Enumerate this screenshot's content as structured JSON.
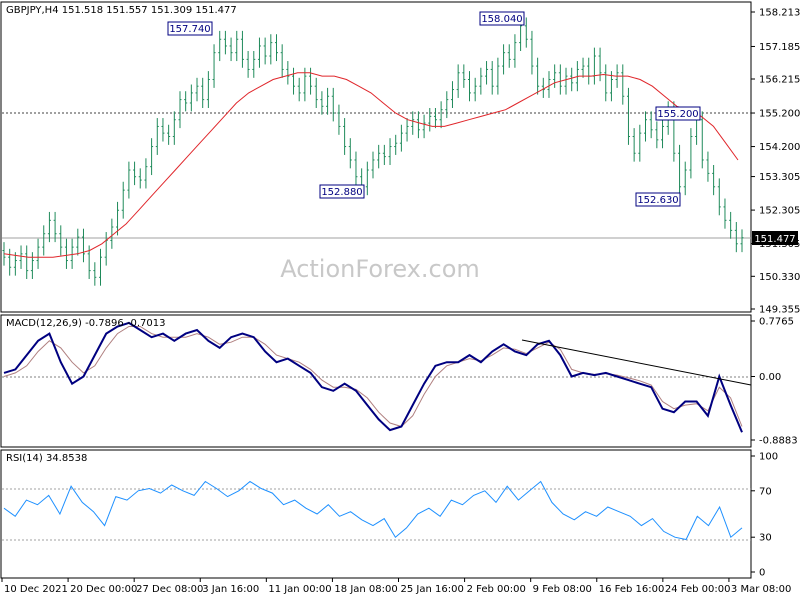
{
  "colors": {
    "background": "#ffffff",
    "candles": "#1f8a5a",
    "ma_line": "#e0262b",
    "macd_line": "#000080",
    "macd_signal": "#a07070",
    "rsi_line": "#1e90ff",
    "grid_dash": "#808080",
    "text": "#000000",
    "price_tag_bg": "#000000"
  },
  "header": {
    "symbol": "GBPJPY,H4",
    "ohlc": "151.518 151.557 151.309 151.477"
  },
  "watermark": "ActionForex.com",
  "chart_data": [
    {
      "type": "candlestick",
      "symbol": "GBPJPY",
      "timeframe": "H4",
      "open": 151.518,
      "high": 151.557,
      "low": 151.309,
      "close": 151.477,
      "current_price_label": "151.477",
      "ylim": [
        149.355,
        158.213
      ],
      "y_ticks": [
        "158.213",
        "157.185",
        "156.215",
        "155.200",
        "154.200",
        "153.305",
        "152.305",
        "151.305",
        "150.330",
        "149.355"
      ],
      "dashed_level": 155.2,
      "annotations": [
        {
          "text": "157.740",
          "value": 157.74
        },
        {
          "text": "158.040",
          "value": 158.04
        },
        {
          "text": "152.880",
          "value": 152.88
        },
        {
          "text": "155.200",
          "value": 155.2
        },
        {
          "text": "152.630",
          "value": 152.63
        }
      ],
      "closes": [
        150.9,
        150.6,
        150.8,
        151.0,
        150.5,
        150.8,
        151.2,
        151.6,
        152.0,
        151.6,
        151.2,
        150.8,
        151.2,
        151.5,
        151.0,
        150.5,
        150.3,
        150.9,
        151.4,
        151.8,
        152.3,
        152.9,
        153.5,
        153.3,
        153.2,
        153.6,
        154.2,
        154.8,
        154.6,
        154.5,
        155.0,
        155.6,
        155.5,
        155.8,
        156.0,
        155.6,
        156.2,
        157.0,
        157.4,
        157.2,
        157.0,
        157.4,
        156.8,
        156.5,
        156.8,
        157.2,
        156.9,
        157.3,
        157.0,
        156.5,
        156.3,
        156.0,
        155.8,
        156.3,
        156.0,
        155.6,
        155.4,
        155.7,
        155.2,
        154.8,
        154.2,
        153.8,
        153.3,
        153.0,
        153.5,
        153.8,
        154.0,
        153.9,
        154.2,
        154.3,
        154.6,
        154.8,
        155.0,
        154.7,
        154.9,
        155.1,
        155.0,
        155.3,
        155.6,
        155.9,
        156.4,
        156.2,
        155.8,
        156.0,
        156.3,
        156.5,
        156.0,
        156.6,
        157.0,
        156.8,
        157.3,
        157.8,
        157.4,
        156.6,
        156.0,
        155.9,
        156.2,
        156.4,
        156.0,
        156.3,
        156.1,
        156.5,
        156.6,
        156.3,
        156.9,
        156.4,
        155.8,
        156.2,
        156.4,
        155.7,
        154.5,
        154.0,
        154.6,
        155.0,
        154.7,
        154.4,
        154.8,
        155.3,
        154.0,
        153.0,
        153.5,
        154.5,
        155.0,
        153.8,
        153.4,
        153.0,
        152.4,
        152.0,
        151.7,
        151.3,
        151.48
      ],
      "ma_values": [
        151.0,
        150.95,
        150.9,
        150.9,
        150.9,
        150.95,
        151.0,
        151.1,
        151.3,
        151.6,
        151.9,
        152.3,
        152.7,
        153.1,
        153.5,
        153.9,
        154.3,
        154.7,
        155.1,
        155.5,
        155.8,
        156.0,
        156.2,
        156.3,
        156.4,
        156.4,
        156.3,
        156.3,
        156.2,
        156.0,
        155.8,
        155.5,
        155.2,
        155.0,
        154.9,
        154.8,
        154.8,
        154.9,
        155.0,
        155.1,
        155.2,
        155.3,
        155.5,
        155.7,
        155.9,
        156.1,
        156.2,
        156.3,
        156.3,
        156.35,
        156.3,
        156.3,
        156.2,
        156.0,
        155.7,
        155.4,
        155.3,
        155.1,
        154.8,
        154.3,
        153.8
      ],
      "time_labels": [
        "10 Dec 2021",
        "20 Dec 00:00",
        "27 Dec 08:00",
        "3 Jan 16:00",
        "11 Jan 00:00",
        "18 Jan 08:00",
        "25 Jan 16:00",
        "2 Feb 00:00",
        "9 Feb 08:00",
        "16 Feb 16:00",
        "24 Feb 00:00",
        "3 Mar 08:00"
      ]
    },
    {
      "type": "line",
      "name": "MACD(12,26,9) -0.7896 -0.7013",
      "ylim": [
        -0.8883,
        0.7765
      ],
      "y_ticks": [
        "0.7765",
        "0.00",
        "-0.8883"
      ],
      "macd": [
        0.05,
        0.1,
        0.3,
        0.5,
        0.6,
        0.2,
        -0.1,
        0.0,
        0.3,
        0.6,
        0.7,
        0.75,
        0.65,
        0.55,
        0.6,
        0.5,
        0.6,
        0.65,
        0.5,
        0.4,
        0.55,
        0.6,
        0.55,
        0.35,
        0.2,
        0.25,
        0.15,
        0.05,
        -0.15,
        -0.2,
        -0.1,
        -0.2,
        -0.4,
        -0.6,
        -0.75,
        -0.7,
        -0.4,
        -0.1,
        0.15,
        0.2,
        0.2,
        0.3,
        0.2,
        0.35,
        0.45,
        0.35,
        0.3,
        0.45,
        0.5,
        0.3,
        0.0,
        0.05,
        0.02,
        0.05,
        0.0,
        -0.05,
        -0.1,
        -0.15,
        -0.45,
        -0.5,
        -0.35,
        -0.35,
        -0.55,
        0.0,
        -0.4,
        -0.78
      ],
      "signal": [
        0.0,
        0.05,
        0.15,
        0.35,
        0.5,
        0.4,
        0.2,
        0.05,
        0.15,
        0.4,
        0.6,
        0.7,
        0.7,
        0.6,
        0.55,
        0.55,
        0.55,
        0.6,
        0.55,
        0.45,
        0.48,
        0.55,
        0.55,
        0.45,
        0.3,
        0.25,
        0.2,
        0.1,
        -0.05,
        -0.15,
        -0.15,
        -0.18,
        -0.3,
        -0.5,
        -0.65,
        -0.7,
        -0.55,
        -0.25,
        0.0,
        0.15,
        0.2,
        0.25,
        0.22,
        0.3,
        0.4,
        0.38,
        0.32,
        0.4,
        0.48,
        0.38,
        0.1,
        0.05,
        0.03,
        0.04,
        0.02,
        -0.02,
        -0.06,
        -0.12,
        -0.35,
        -0.45,
        -0.4,
        -0.38,
        -0.48,
        -0.15,
        -0.3,
        -0.7
      ],
      "trendline": true
    },
    {
      "type": "line",
      "name": "RSI(14) 34.8538",
      "ylim": [
        0,
        100
      ],
      "y_ticks": [
        "100",
        "70",
        "30",
        "0"
      ],
      "levels": [
        70,
        30
      ],
      "values": [
        55,
        48,
        62,
        58,
        66,
        50,
        74,
        60,
        52,
        40,
        65,
        62,
        70,
        72,
        68,
        75,
        70,
        66,
        78,
        72,
        65,
        70,
        78,
        72,
        68,
        58,
        62,
        55,
        50,
        58,
        48,
        52,
        45,
        40,
        46,
        30,
        38,
        50,
        55,
        48,
        62,
        58,
        66,
        70,
        60,
        74,
        62,
        70,
        78,
        60,
        50,
        45,
        52,
        48,
        56,
        52,
        48,
        40,
        46,
        35,
        30,
        28,
        48,
        40,
        56,
        30,
        38
      ]
    }
  ]
}
